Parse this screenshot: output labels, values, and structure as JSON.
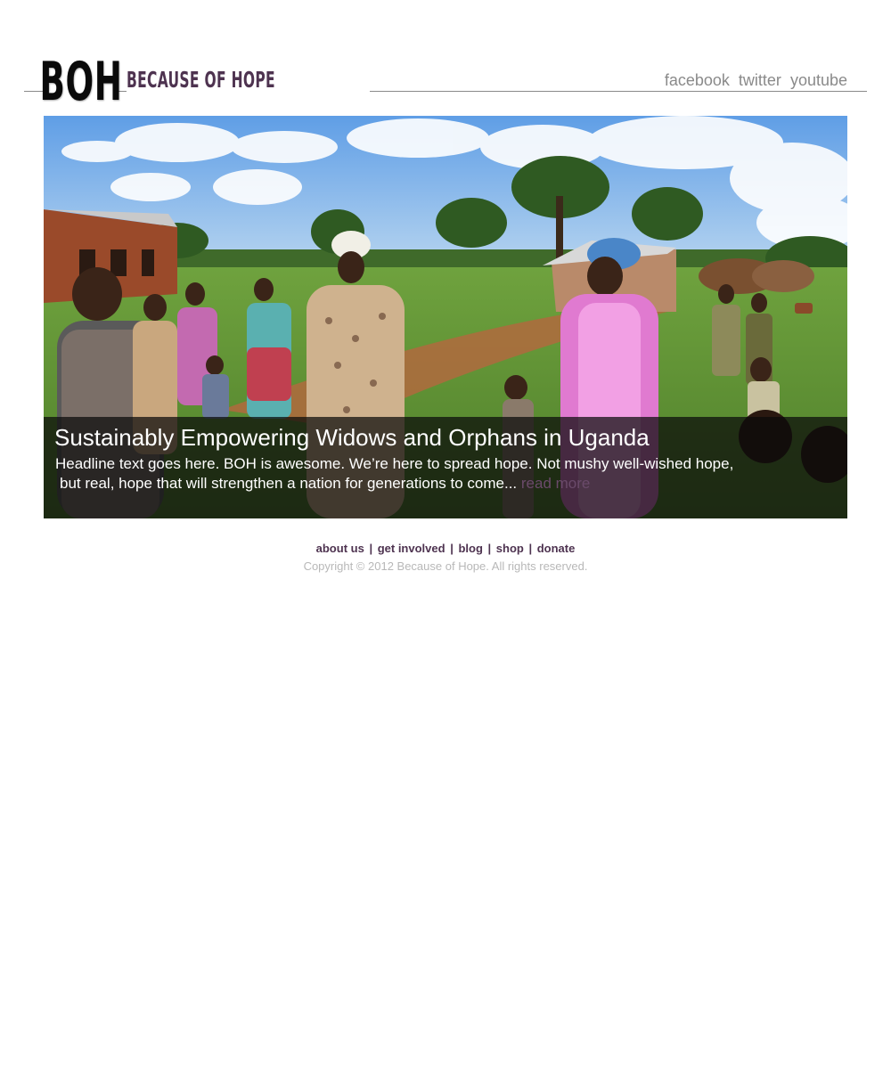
{
  "colors": {
    "brand_purple": "#4e3350",
    "social_gray": "#8a8a8a",
    "read_more": "#6a4a6a",
    "copyright_gray": "#b8b8b8",
    "caption_overlay": "#0a0a0a"
  },
  "header": {
    "logo_mark": "BOH",
    "logo_name": "BECAUSE OF HOPE",
    "social": [
      {
        "label": "facebook"
      },
      {
        "label": "twitter"
      },
      {
        "label": "youtube"
      }
    ]
  },
  "hero": {
    "image_alt": "Women and children walking outdoors in a rural village in Uganda",
    "title": "Sustainably Empowering Widows and Orphans in Uganda",
    "body_line1": "Headline text goes here. BOH is awesome. We’re here to spread hope. Not mushy well-wished hope,",
    "body_line2": "but real, hope that will strengthen a nation for generations to come...",
    "read_more": "read more"
  },
  "footer": {
    "nav": [
      {
        "label": "about us"
      },
      {
        "label": "get involved"
      },
      {
        "label": "blog"
      },
      {
        "label": "shop"
      },
      {
        "label": "donate"
      }
    ],
    "separator": "|",
    "copyright": "Copyright © 2012 Because of Hope. All rights reserved."
  }
}
